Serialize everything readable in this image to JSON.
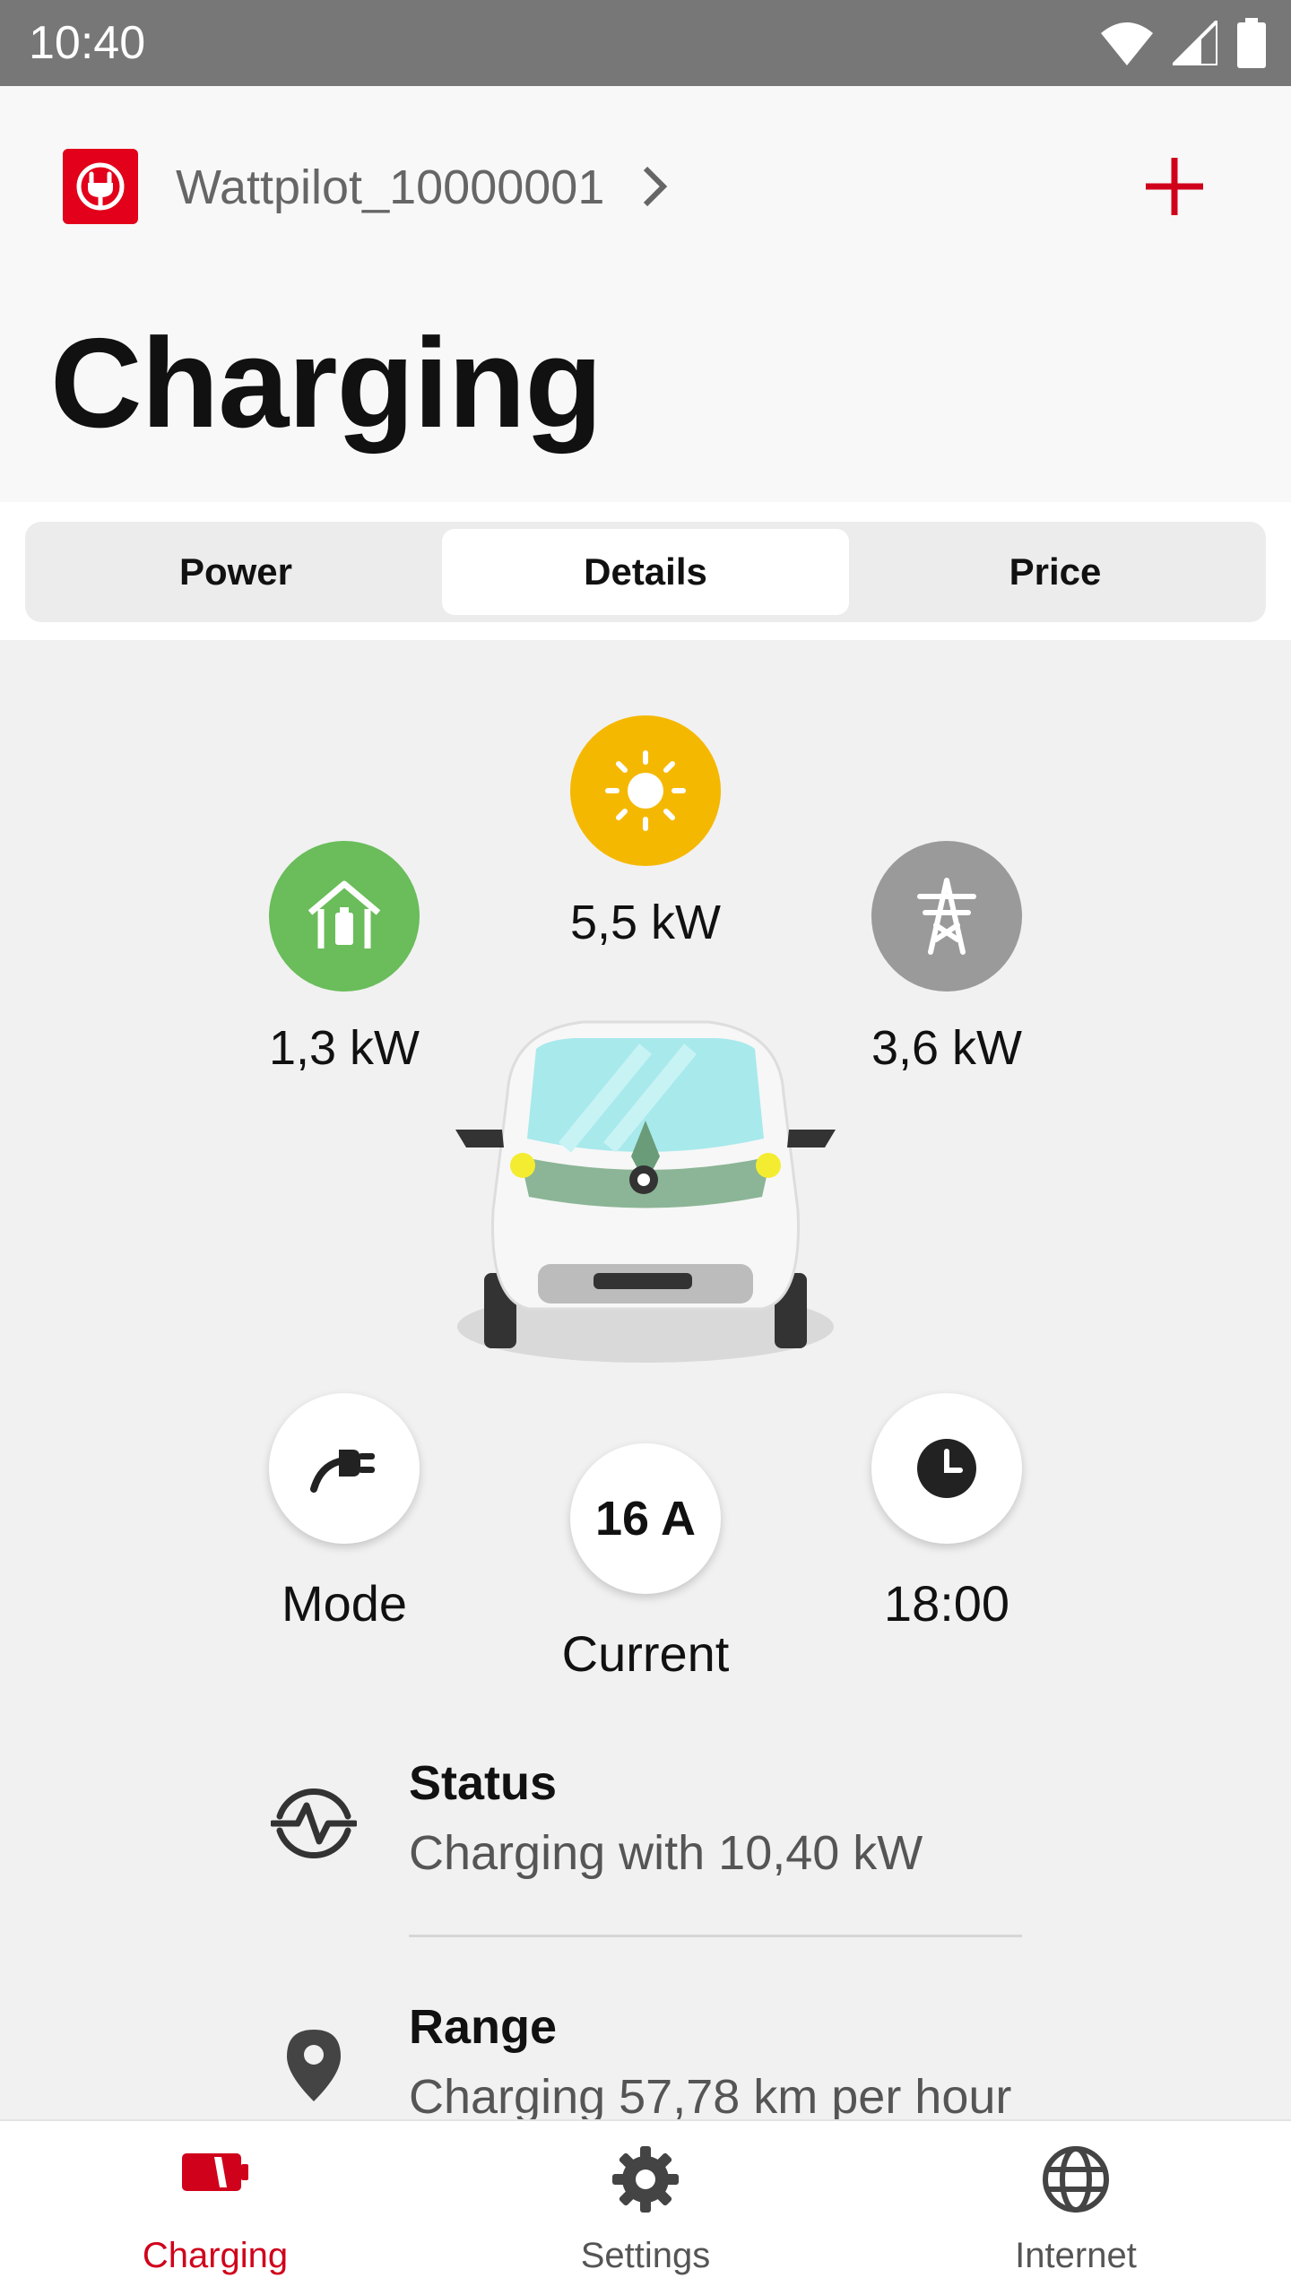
{
  "status_bar": {
    "time": "10:40"
  },
  "header": {
    "device_name": "Wattpilot_10000001",
    "title": "Charging"
  },
  "tabs": [
    {
      "label": "Power"
    },
    {
      "label": "Details"
    },
    {
      "label": "Price"
    }
  ],
  "active_tab": "Details",
  "flow": {
    "home": {
      "value": "1,3 kW",
      "icon": "home-battery-icon",
      "color": "#6abd5a"
    },
    "solar": {
      "value": "5,5 kW",
      "icon": "sun-icon",
      "color": "#f5b800"
    },
    "grid": {
      "value": "3,6 kW",
      "icon": "power-pylon-icon",
      "color": "#9a9a9a"
    }
  },
  "controls": {
    "mode": {
      "label": "Mode",
      "icon": "plug-icon"
    },
    "current": {
      "value": "16 A",
      "label": "Current"
    },
    "timer": {
      "label": "18:00",
      "icon": "clock-icon"
    }
  },
  "info": [
    {
      "title": "Status",
      "value": "Charging with 10,40 kW",
      "icon": "activity-icon"
    },
    {
      "title": "Range",
      "value": "Charging 57,78 km per hour",
      "icon": "location-pin-icon"
    }
  ],
  "bottom_nav": [
    {
      "label": "Charging",
      "icon": "charging-icon",
      "active": true
    },
    {
      "label": "Settings",
      "icon": "gear-icon",
      "active": false
    },
    {
      "label": "Internet",
      "icon": "globe-icon",
      "active": false
    }
  ],
  "colors": {
    "accent": "#d0021b",
    "brand_red": "#e2001a"
  }
}
